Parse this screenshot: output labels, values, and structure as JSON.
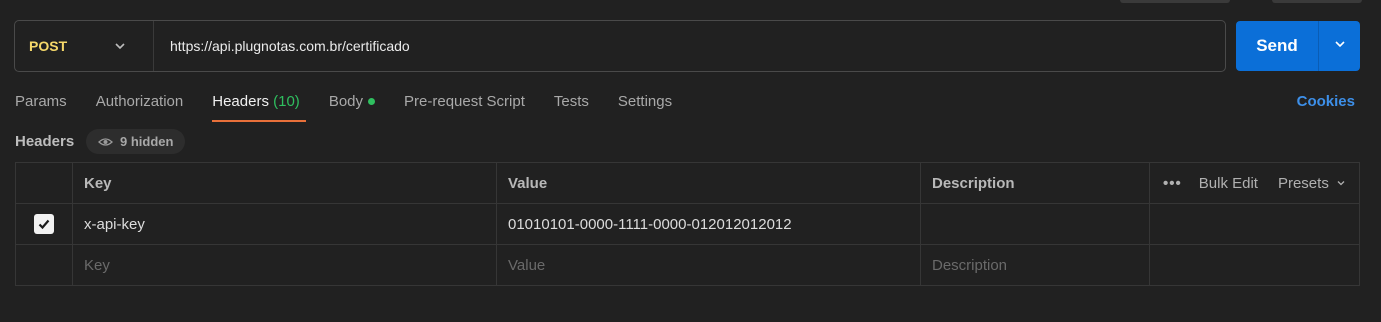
{
  "request": {
    "method": "POST",
    "url": "https://api.plugnotas.com.br/certificado",
    "send_label": "Send"
  },
  "tabs": [
    {
      "label": "Params"
    },
    {
      "label": "Authorization"
    },
    {
      "label": "Headers",
      "count": "(10)"
    },
    {
      "label": "Body"
    },
    {
      "label": "Pre-request Script"
    },
    {
      "label": "Tests"
    },
    {
      "label": "Settings"
    }
  ],
  "cookies_label": "Cookies",
  "headers_section": {
    "title": "Headers",
    "hidden_label": "9 hidden"
  },
  "table": {
    "columns": {
      "key": "Key",
      "value": "Value",
      "description": "Description"
    },
    "actions": {
      "more": "•••",
      "bulk_edit": "Bulk Edit",
      "presets": "Presets"
    },
    "rows": [
      {
        "checked": true,
        "key": "x-api-key",
        "value": "01010101-0000-1111-0000-012012012012",
        "description": ""
      }
    ],
    "placeholders": {
      "key": "Key",
      "value": "Value",
      "description": "Description"
    }
  },
  "colors": {
    "method": "#f5d86a",
    "send": "#0b6fd8",
    "active_tab_underline": "#e8703a",
    "count": "#2fbf5f",
    "cookies": "#3d8fe8"
  }
}
